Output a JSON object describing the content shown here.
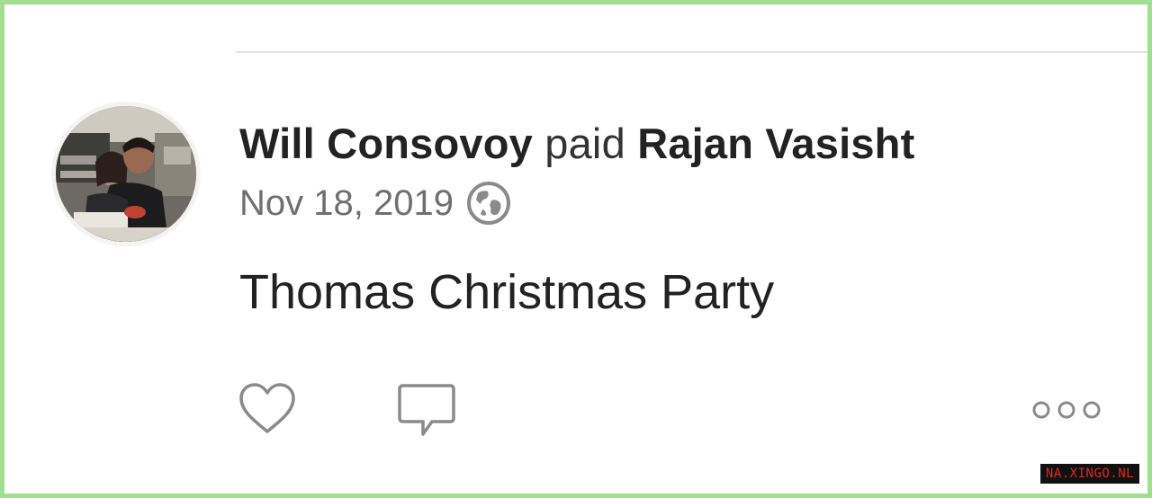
{
  "feed_item": {
    "payer": "Will Consovoy",
    "verb": "paid",
    "payee": "Rajan Vasisht",
    "date": "Nov 18, 2019",
    "privacy_icon": "globe-icon",
    "note": "Thomas Christmas Party"
  },
  "actions": {
    "like_icon": "heart-icon",
    "comment_icon": "comment-icon",
    "more_icon": "more-options-icon"
  },
  "watermark": {
    "text": "NA.XINGO.NL"
  },
  "colors": {
    "frame_border": "#9fdf8f",
    "primary_text": "#222222",
    "secondary_text": "#6f6f6f",
    "icon_gray": "#8a8a8a",
    "watermark_bg": "#111111",
    "watermark_text": "#e0261c"
  }
}
